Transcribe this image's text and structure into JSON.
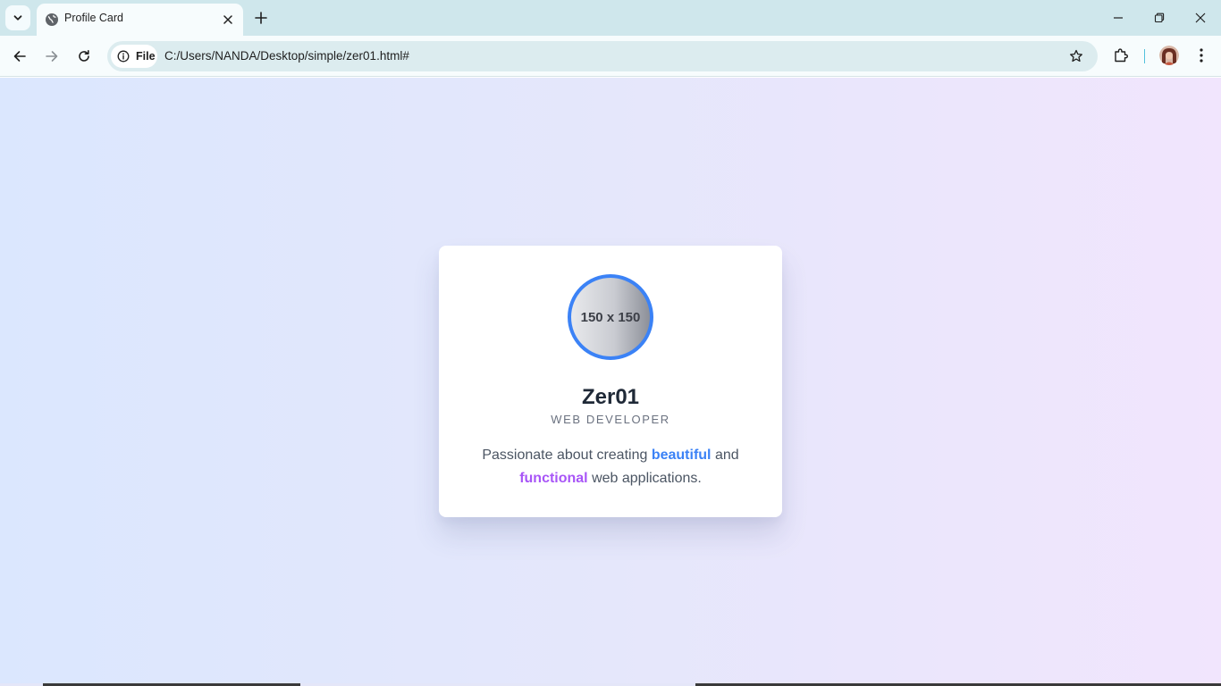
{
  "browser": {
    "tab_title": "Profile Card",
    "site_chip_label": "File",
    "url": "C:/Users/NANDA/Desktop/simple/zer01.html#"
  },
  "card": {
    "image_placeholder": "150 x 150",
    "name": "Zer01",
    "role": "WEB DEVELOPER",
    "bio": {
      "part1": "Passionate about creating ",
      "highlight1": "beautiful",
      "part2": " and ",
      "highlight2": "functional",
      "part3": " web applications."
    }
  },
  "colors": {
    "accent_blue": "#3b82f6",
    "accent_purple": "#a855f7",
    "name_text": "#1f2937",
    "tabstrip_bg": "#cfe7ec"
  },
  "icons": {
    "tab_search": "chevron-down-icon",
    "favicon": "globe-icon",
    "tab_close": "close-icon",
    "new_tab": "plus-icon",
    "back": "arrow-left-icon",
    "forward": "arrow-right-icon",
    "reload": "reload-icon",
    "site_info": "info-icon",
    "bookmark": "star-icon",
    "extensions": "puzzle-icon",
    "menu": "kebab-menu-icon"
  }
}
